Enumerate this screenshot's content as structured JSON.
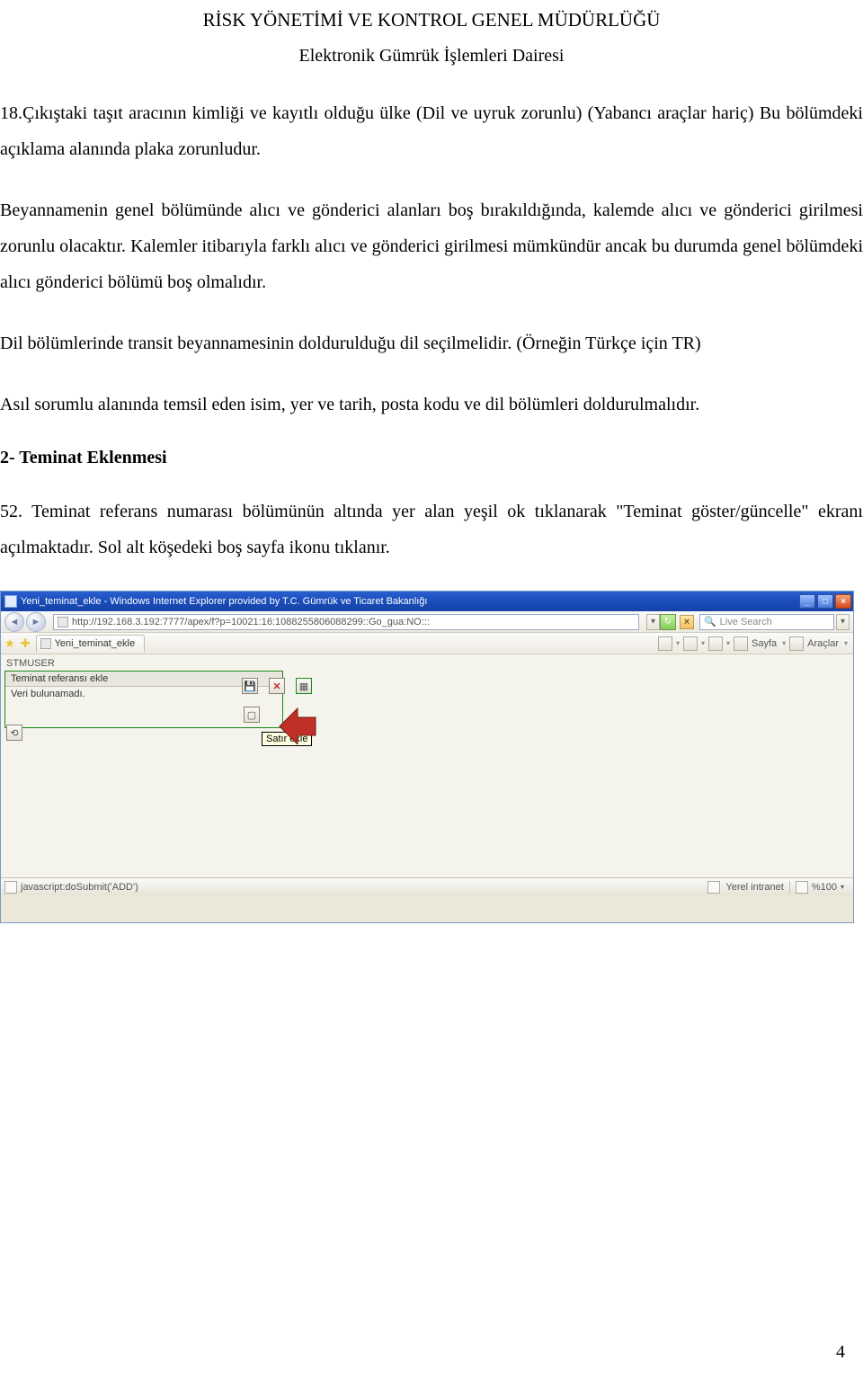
{
  "header": {
    "title": "RİSK YÖNETİMİ VE KONTROL GENEL MÜDÜRLÜĞÜ",
    "subtitle": "Elektronik Gümrük İşlemleri Dairesi"
  },
  "paragraphs": {
    "p1": "18.Çıkıştaki taşıt aracının kimliği ve kayıtlı olduğu ülke (Dil ve uyruk zorunlu) (Yabancı araçlar hariç) Bu bölümdeki açıklama alanında plaka zorunludur.",
    "p2": "Beyannamenin genel bölümünde alıcı ve gönderici alanları boş bırakıldığında, kalemde alıcı ve gönderici girilmesi zorunlu olacaktır. Kalemler itibarıyla farklı alıcı ve gönderici girilmesi mümkündür ancak bu durumda genel bölümdeki alıcı gönderici bölümü boş olmalıdır.",
    "p3": "Dil bölümlerinde transit beyannamesinin doldurulduğu dil seçilmelidir. (Örneğin Türkçe için TR)",
    "p4": "Asıl sorumlu alanında temsil eden isim, yer ve tarih, posta kodu ve dil bölümleri doldurulmalıdır.",
    "heading2": "2- Teminat Eklenmesi",
    "p5": "52. Teminat referans numarası bölümünün altında yer alan yeşil ok tıklanarak \"Teminat göster/güncelle\" ekranı açılmaktadır. Sol alt köşedeki boş sayfa ikonu tıklanır."
  },
  "ie": {
    "title": "Yeni_teminat_ekle - Windows Internet Explorer provided by T.C. Gümrük ve Ticaret Bakanlığı",
    "url": "http://192.168.3.192:7777/apex/f?p=10021:16:1088255806088299::Go_gua:NO:::",
    "search_placeholder": "Live Search",
    "tab": "Yeni_teminat_ekle",
    "toolbar": {
      "sayfa": "Sayfa",
      "araclar": "Araçlar"
    },
    "content": {
      "user": "STMUSER",
      "panel_header": "Teminat referansı ekle",
      "not_found": "Veri bulunamadı.",
      "tooltip": "Satır ekle"
    },
    "status": {
      "left": "javascript:doSubmit('ADD')",
      "zone": "Yerel intranet",
      "zoom": "%100"
    },
    "title_buttons": {
      "min": "_",
      "max": "□",
      "close": "×"
    }
  },
  "page_number": "4"
}
